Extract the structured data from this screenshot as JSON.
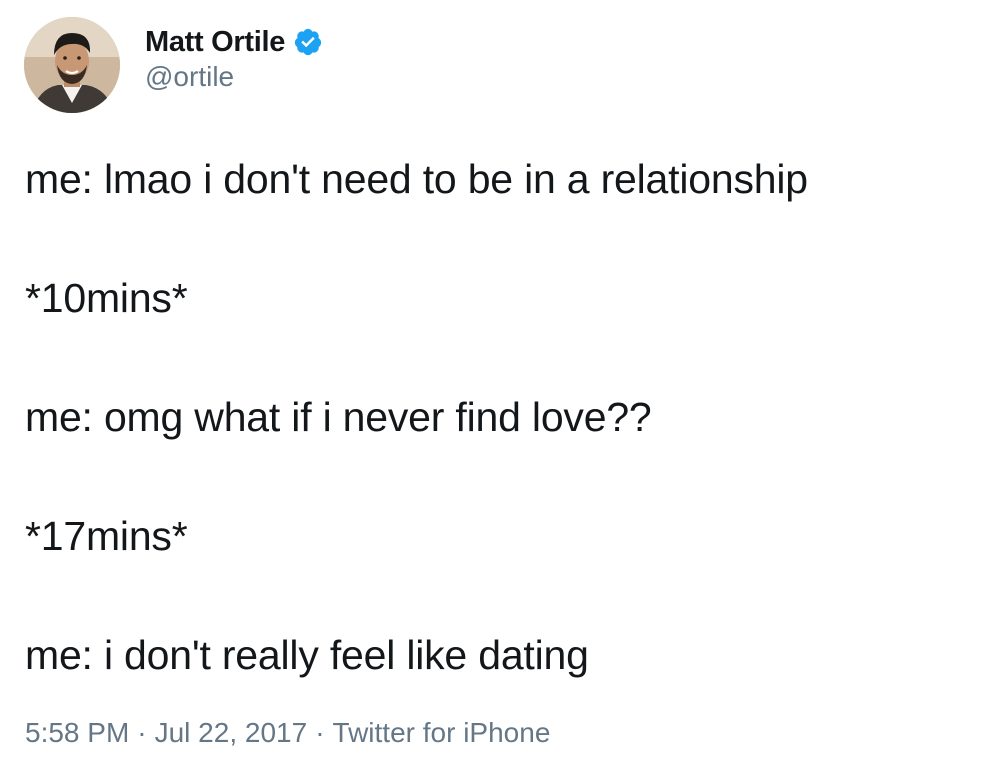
{
  "author": {
    "display_name": "Matt Ortile",
    "handle": "@ortile",
    "verified_icon": "verified-badge-icon",
    "verified_color": "#1da1f2"
  },
  "tweet": {
    "lines": [
      "me: lmao i don't need to be in a relationship",
      "*10mins*",
      "me: omg what if i never find love??",
      "*17mins*",
      "me: i don't really feel like dating"
    ]
  },
  "meta": {
    "time": "5:58 PM",
    "separator": "·",
    "date": "Jul 22, 2017",
    "source": "Twitter for iPhone"
  },
  "colors": {
    "text": "#14171a",
    "secondary": "#657786",
    "background": "#ffffff"
  }
}
